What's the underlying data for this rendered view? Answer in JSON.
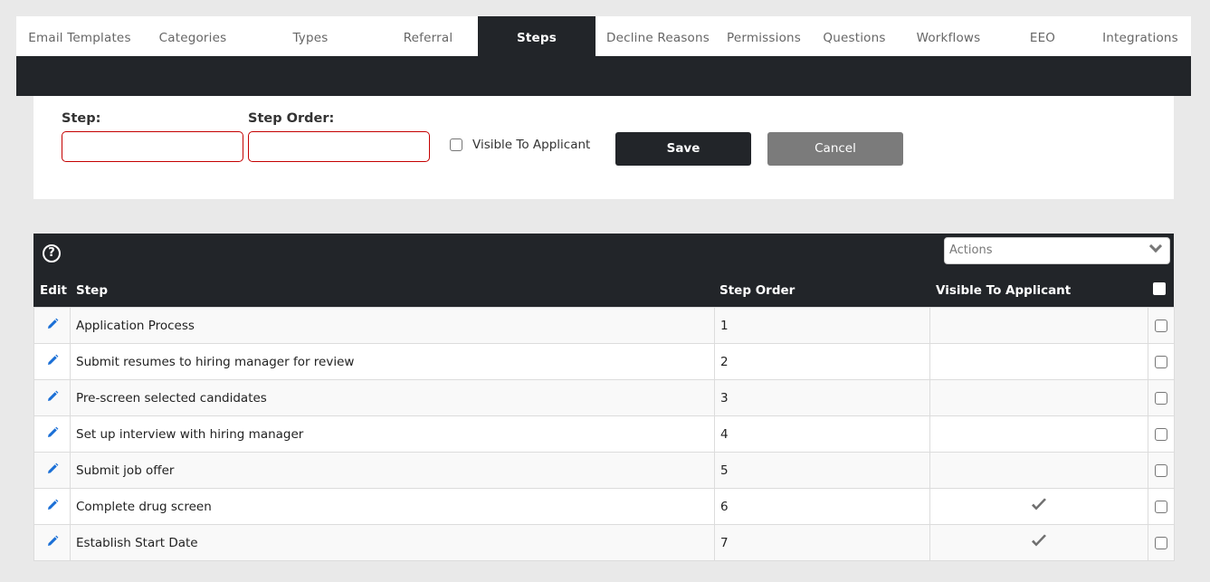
{
  "tabs": [
    {
      "label": "Email Templates",
      "active": false
    },
    {
      "label": "Categories",
      "active": false
    },
    {
      "label": "Types",
      "active": false
    },
    {
      "label": "Referral",
      "active": false
    },
    {
      "label": "Steps",
      "active": true
    },
    {
      "label": "Decline Reasons",
      "active": false
    },
    {
      "label": "Permissions",
      "active": false
    },
    {
      "label": "Questions",
      "active": false
    },
    {
      "label": "Workflows",
      "active": false
    },
    {
      "label": "EEO",
      "active": false
    },
    {
      "label": "Integrations",
      "active": false
    }
  ],
  "form": {
    "step_label": "Step:",
    "step_value": "",
    "order_label": "Step Order:",
    "order_value": "",
    "visible_label": "Visible To Applicant",
    "visible_checked": false,
    "save_label": "Save",
    "cancel_label": "Cancel"
  },
  "grid": {
    "help_icon": "help-circle-icon",
    "actions_placeholder": "Actions",
    "headers": {
      "edit": "Edit",
      "step": "Step",
      "order": "Step Order",
      "visible": "Visible To Applicant"
    },
    "rows": [
      {
        "step": "Application Process",
        "order": "1",
        "visible": false
      },
      {
        "step": "Submit resumes to hiring manager for review",
        "order": "2",
        "visible": false
      },
      {
        "step": "Pre-screen selected candidates",
        "order": "3",
        "visible": false
      },
      {
        "step": "Set up interview with hiring manager",
        "order": "4",
        "visible": false
      },
      {
        "step": "Submit job offer",
        "order": "5",
        "visible": false
      },
      {
        "step": "Complete drug screen",
        "order": "6",
        "visible": true
      },
      {
        "step": "Establish Start Date",
        "order": "7",
        "visible": true
      }
    ]
  },
  "colors": {
    "dark": "#222529",
    "required_border": "#c40000",
    "edit_icon": "#1a6fd6",
    "check_icon": "#6f6f6f"
  }
}
